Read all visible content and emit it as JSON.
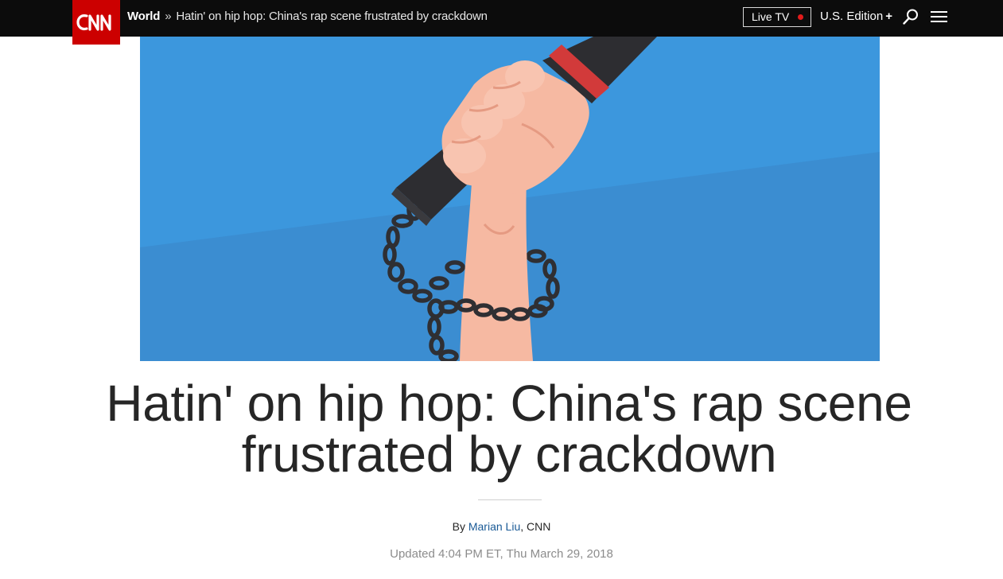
{
  "header": {
    "logo_text": "CNN",
    "section": "World",
    "separator": "»",
    "breadcrumb_title": "Hatin' on hip hop: China's rap scene frustrated by crackdown",
    "live_tv_label": "Live TV",
    "edition_label": "U.S. Edition",
    "edition_plus": "+",
    "icons": [
      "search-icon",
      "hamburger-menu-icon"
    ]
  },
  "article": {
    "headline": "Hatin' on hip hop: China's rap scene frustrated by crackdown",
    "byline_prefix": "By ",
    "author": "Marian Liu",
    "byline_suffix": ", CNN",
    "updated": "Updated 4:04 PM ET, Thu March 29, 2018"
  },
  "colors": {
    "brand_red": "#cc0000",
    "header_bg": "#0c0c0c",
    "hero_sky": "#3c97dd",
    "hero_lower": "#3b8dd1",
    "author_link": "#1a5a96",
    "live_dot": "#e21b1b"
  }
}
